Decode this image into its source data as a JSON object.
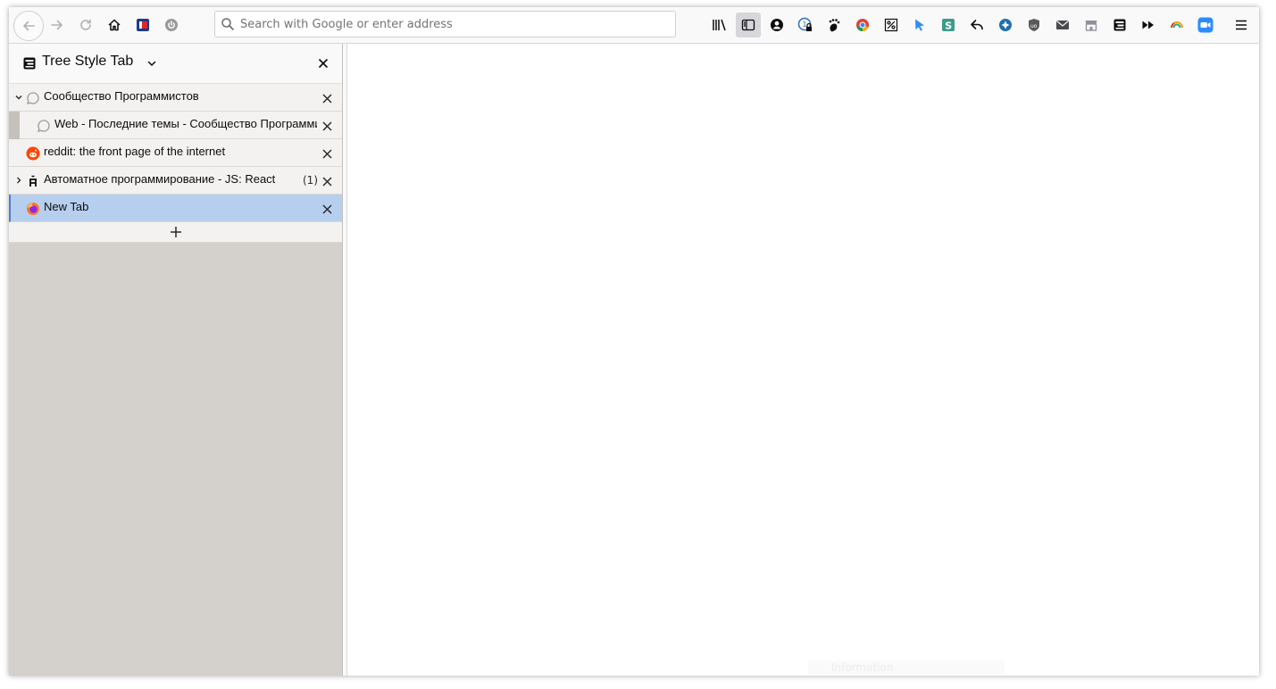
{
  "toolbar": {
    "nav_icons": [
      "back-arrow-icon",
      "forward-arrow-icon",
      "reload-icon",
      "home-icon",
      "addon-red-blue-icon",
      "power-icon"
    ],
    "search_placeholder": "Search with Google or enter address",
    "right_icons": [
      "library-icon",
      "sidebar-toggle-icon",
      "account-icon",
      "password-lock-icon",
      "gnome-foot-icon",
      "chrome-ball-icon",
      "percent-icon",
      "cursor-arrow-icon",
      "s-square-icon",
      "reply-arrow-icon",
      "blue-circle-icon",
      "ublock-shield-icon",
      "mail-icon",
      "storefront-icon",
      "tree-tab-icon",
      "fast-forward-icon",
      "rainbow-arc-icon",
      "video-camera-icon",
      "hamburger-menu-icon"
    ]
  },
  "sidebar": {
    "title": "Tree Style Tab",
    "tabs": [
      {
        "title": "Сообщество Программистов",
        "level": 0,
        "twisty": "expanded",
        "favicon": "speech-bubble-icon",
        "counter": ""
      },
      {
        "title": "Web - Последние темы - Сообщество Программистов",
        "level": 1,
        "twisty": "",
        "favicon": "speech-bubble-icon",
        "counter": ""
      },
      {
        "title": "reddit: the front page of the internet",
        "level": 0,
        "twisty": "",
        "favicon": "reddit-icon",
        "counter": ""
      },
      {
        "title": "Автоматное программирование - JS: React",
        "level": 0,
        "twisty": "collapsed",
        "favicon": "hexlet-icon",
        "counter": "(1)"
      },
      {
        "title": "New Tab",
        "level": 0,
        "twisty": "",
        "favicon": "firefox-icon",
        "counter": "",
        "active": true
      }
    ]
  },
  "ghost_text": "Information",
  "colors": {
    "active_tab": "#b6cfee",
    "active_border": "#4d7fd1",
    "sidebar_bg": "#d4d0cb",
    "toolbar_bg": "#f9f9fa"
  }
}
